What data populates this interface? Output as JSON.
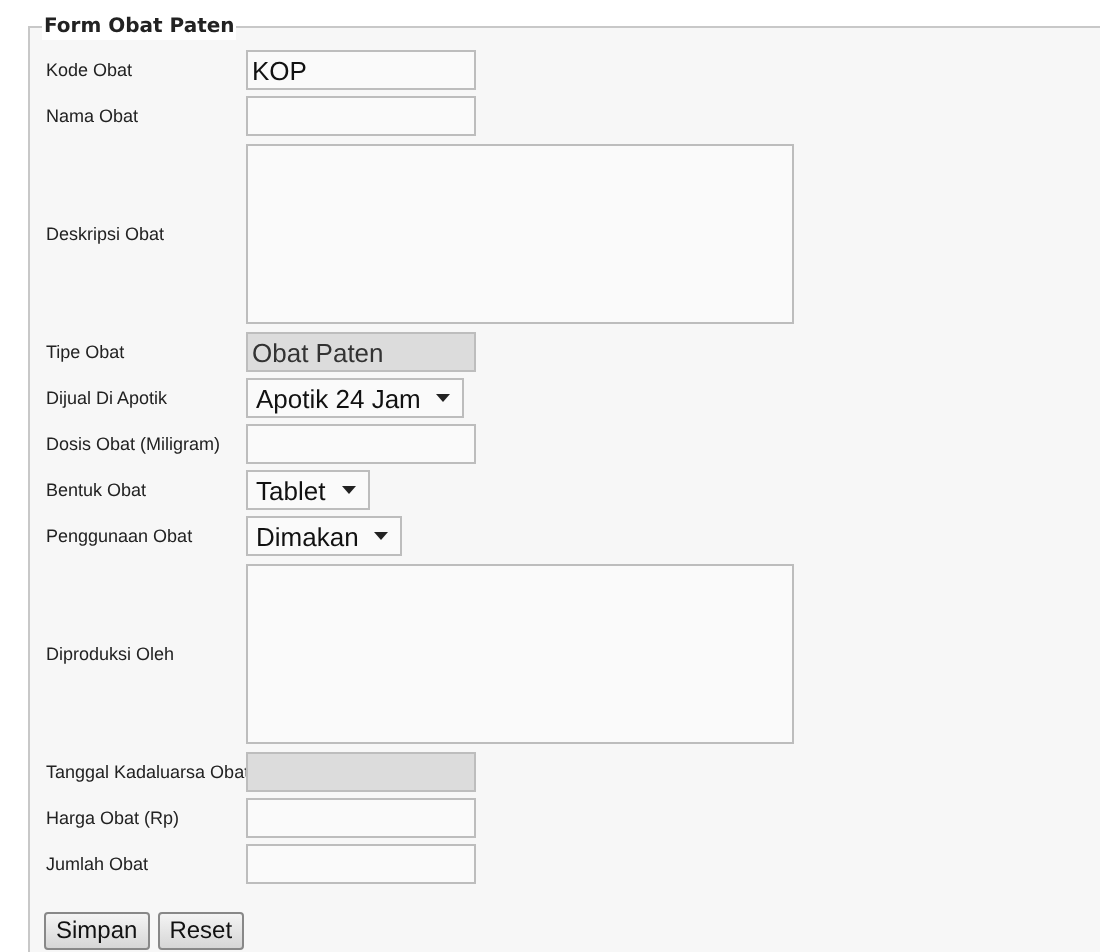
{
  "form": {
    "legend": "Form Obat Paten",
    "fields": [
      {
        "label": "Kode Obat",
        "kind": "text",
        "value": "KOP",
        "disabled": false
      },
      {
        "label": "Nama Obat",
        "kind": "text",
        "disabled": false
      },
      {
        "label": "Deskripsi Obat",
        "kind": "textarea"
      },
      {
        "label": "Tipe Obat",
        "kind": "text",
        "value": "Obat Paten",
        "disabled": true
      },
      {
        "label": "Dijual Di Apotik",
        "kind": "select",
        "value": "Apotik 24 Jam"
      },
      {
        "label": "Dosis Obat (Miligram)",
        "kind": "text",
        "disabled": false
      },
      {
        "label": "Bentuk Obat",
        "kind": "select",
        "value": "Tablet"
      },
      {
        "label": "Penggunaan Obat",
        "kind": "select",
        "value": "Dimakan"
      },
      {
        "label": "Diproduksi Oleh",
        "kind": "textarea"
      },
      {
        "label": "Tanggal Kadaluarsa Obat",
        "kind": "text",
        "disabled": true
      },
      {
        "label": "Harga Obat (Rp)",
        "kind": "text",
        "disabled": false
      },
      {
        "label": "Jumlah Obat",
        "kind": "text",
        "disabled": false
      }
    ],
    "buttons": [
      "Simpan",
      "Reset"
    ]
  }
}
